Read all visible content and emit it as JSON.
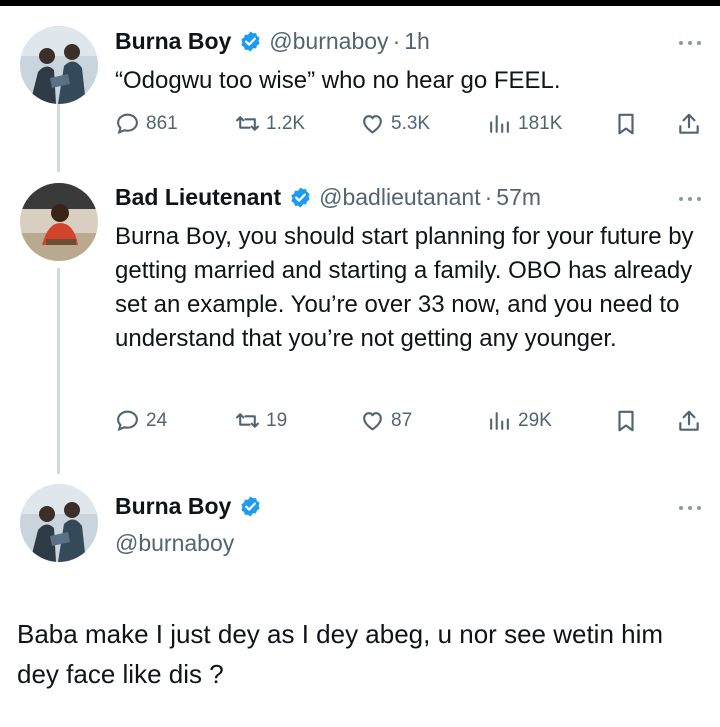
{
  "tweets": [
    {
      "name": "Burna Boy",
      "handle": "@burnaboy",
      "time": "1h",
      "text": "“Odogwu too wise”  who no hear go FEEL.",
      "stats": {
        "replies": "861",
        "retweets": "1.2K",
        "likes": "5.3K",
        "views": "181K"
      }
    },
    {
      "name": "Bad Lieutenant",
      "handle": "@badlieutanant",
      "time": "57m",
      "text": "Burna Boy, you should start planning for your future by getting married and starting a family. OBO has already set an example. You’re over 33 now, and you need to understand that you’re not getting any younger.",
      "stats": {
        "replies": "24",
        "retweets": "19",
        "likes": "87",
        "views": "29K"
      }
    }
  ],
  "compose": {
    "name": "Burna Boy",
    "handle": "@burnaboy"
  },
  "caption": "Baba make I just dey as I dey abeg, u nor see wetin him dey face like dis ?",
  "colors": {
    "verified": "#1d9bf0",
    "secondary_text": "#536471",
    "thread_line": "#cfd9de"
  },
  "icons": [
    "verified-badge-icon",
    "more-icon",
    "reply-icon",
    "retweet-icon",
    "like-icon",
    "views-icon",
    "bookmark-icon",
    "share-icon"
  ]
}
